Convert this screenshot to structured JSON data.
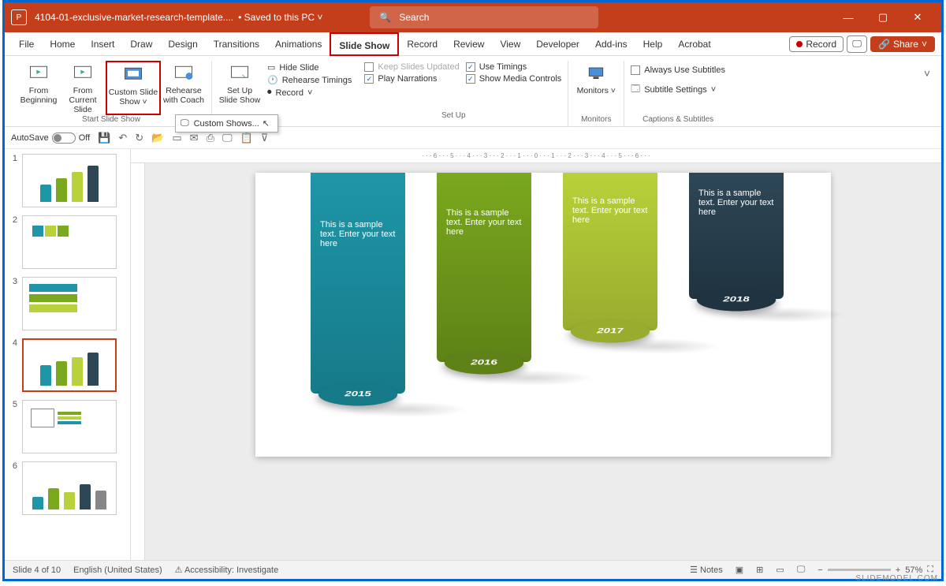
{
  "title": {
    "document": "4104-01-exclusive-market-research-template....",
    "saved": "Saved to this PC",
    "search_placeholder": "Search"
  },
  "menus": [
    "File",
    "Home",
    "Insert",
    "Draw",
    "Design",
    "Transitions",
    "Animations",
    "Slide Show",
    "Record",
    "Review",
    "View",
    "Developer",
    "Add-ins",
    "Help",
    "Acrobat"
  ],
  "menu_active": "Slide Show",
  "menu_controls": {
    "record": "Record",
    "share": "Share"
  },
  "ribbon": {
    "start": {
      "label": "Start Slide Show",
      "from_beginning": "From Beginning",
      "from_current": "From Current Slide",
      "custom_show": "Custom Slide Show",
      "rehearse_coach": "Rehearse with Coach"
    },
    "setup": {
      "label": "Set Up",
      "setup_show": "Set Up Slide Show",
      "hide_slide": "Hide Slide",
      "rehearse_timings": "Rehearse Timings",
      "record_menu": "Record",
      "keep_updated": "Keep Slides Updated",
      "play_narrations": "Play Narrations",
      "use_timings": "Use Timings",
      "show_media": "Show Media Controls"
    },
    "monitors": {
      "label": "Monitors",
      "button": "Monitors"
    },
    "captions": {
      "label": "Captions & Subtitles",
      "always": "Always Use Subtitles",
      "settings": "Subtitle Settings"
    },
    "dropdown_item": "Custom Shows..."
  },
  "qat": {
    "autosave": "AutoSave",
    "autosave_state": "Off"
  },
  "thumbnails": [
    {
      "n": "1"
    },
    {
      "n": "2"
    },
    {
      "n": "3"
    },
    {
      "n": "4",
      "selected": true
    },
    {
      "n": "5"
    },
    {
      "n": "6"
    }
  ],
  "slide": {
    "text": "This is a sample text. Enter your text here",
    "years": [
      "2015",
      "2016",
      "2017",
      "2018"
    ],
    "colors": {
      "c1": "#1e96a8",
      "c1d": "#167a89",
      "c2": "#7aa81e",
      "c2d": "#5e8217",
      "c3": "#b9d13a",
      "c3d": "#99ac2e",
      "c4": "#2e4756",
      "c4d": "#1f3340"
    }
  },
  "status": {
    "slide_info": "Slide 4 of 10",
    "language": "English (United States)",
    "accessibility": "Accessibility: Investigate",
    "notes": "Notes",
    "zoom": "57%"
  },
  "watermark": "SLIDEMODEL.COM"
}
